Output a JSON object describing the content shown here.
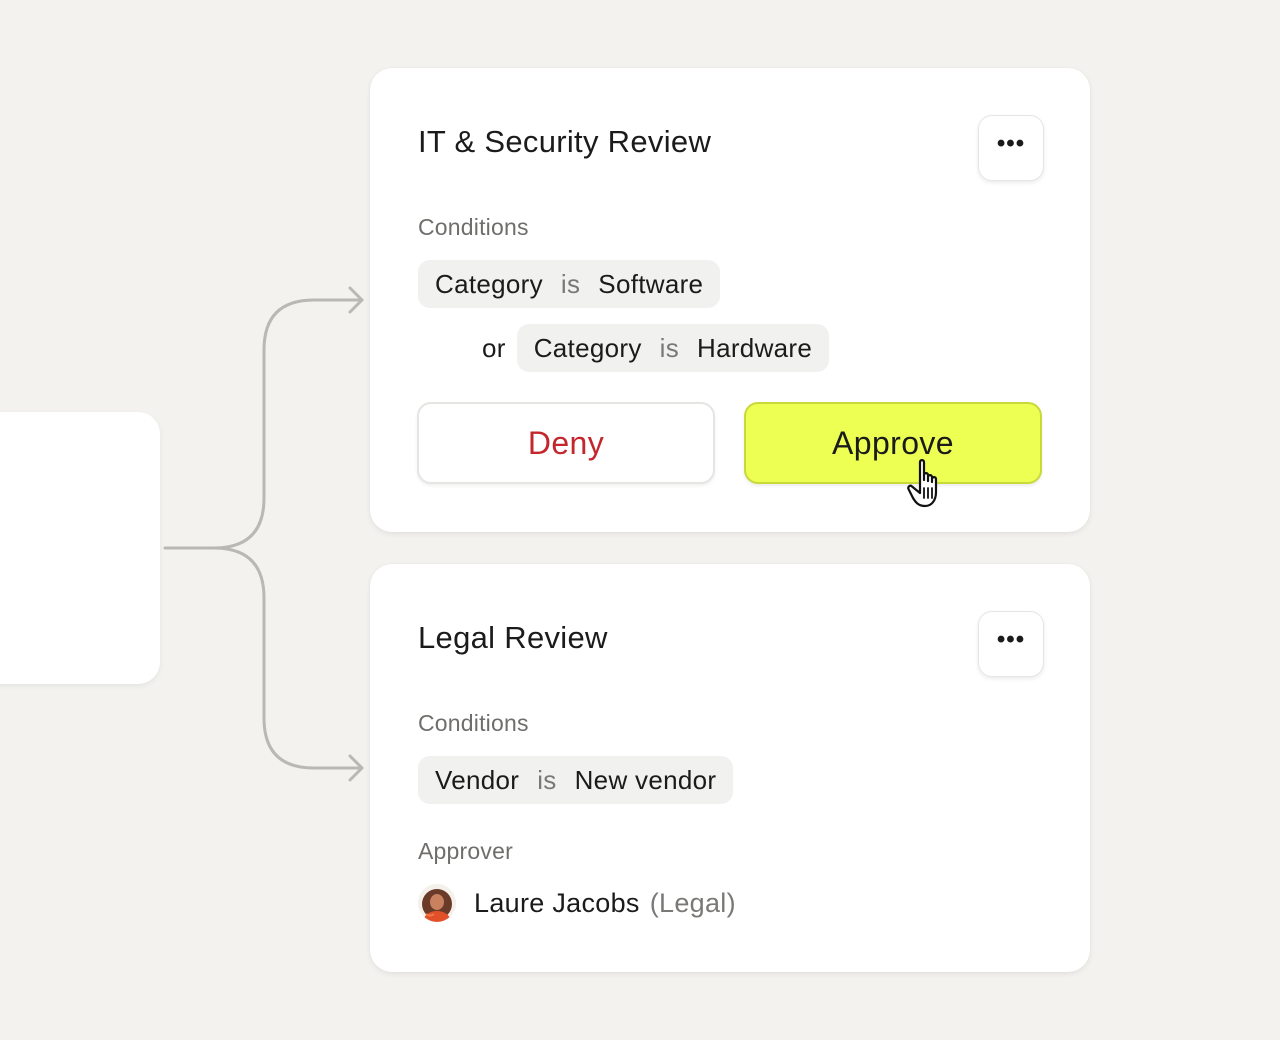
{
  "cards": [
    {
      "title": "IT & Security Review",
      "more_label": "•••",
      "conditions_label": "Conditions",
      "conditions": [
        {
          "field": "Category",
          "operator": "is",
          "value": "Software"
        },
        {
          "connector": "or",
          "field": "Category",
          "operator": "is",
          "value": "Hardware"
        }
      ],
      "deny_label": "Deny",
      "approve_label": "Approve"
    },
    {
      "title": "Legal Review",
      "more_label": "•••",
      "conditions_label": "Conditions",
      "conditions": [
        {
          "field": "Vendor",
          "operator": "is",
          "value": "New vendor"
        }
      ],
      "approver_label": "Approver",
      "approver": {
        "name": "Laure Jacobs",
        "role": "(Legal)"
      }
    }
  ],
  "colors": {
    "background": "#f3f2ef",
    "approve": "#ecff52",
    "deny_text": "#c4262e",
    "connector": "#b9b8b4"
  },
  "icons": {
    "more": "more-horizontal-icon",
    "cursor": "hand-pointer-icon",
    "arrow": "arrow-right-icon"
  }
}
